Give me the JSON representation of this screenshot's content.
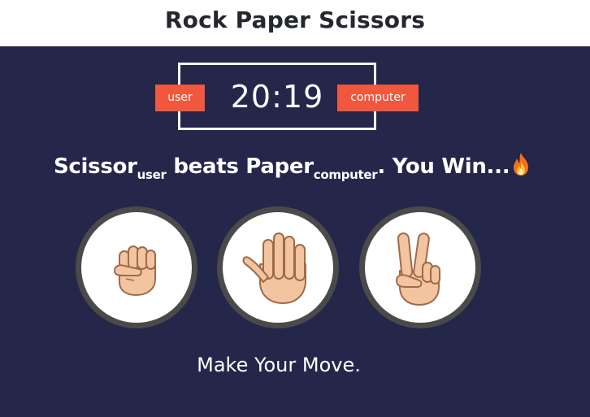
{
  "header": {
    "title": "Rock Paper Scissors"
  },
  "scoreboard": {
    "score": "20:19",
    "user_label": "user",
    "computer_label": "computer"
  },
  "result": {
    "user_choice": "Scissor",
    "user_tag": "user",
    "verb": " beats ",
    "computer_choice": "Paper",
    "computer_tag": "computer",
    "outcome": ". You Win...",
    "emoji": "fire-icon"
  },
  "choices": [
    {
      "name": "rock",
      "icon": "rock-fist-icon"
    },
    {
      "name": "paper",
      "icon": "paper-hand-icon"
    },
    {
      "name": "scissors",
      "icon": "scissors-hand-icon"
    }
  ],
  "prompt": "Make Your Move.",
  "colors": {
    "background": "#24264a",
    "header_bg": "#ffffff",
    "badge": "#f0573d",
    "choice_border": "#4a4a4a",
    "skin": "#f2c4a0",
    "skin_outline": "#a06a48"
  }
}
